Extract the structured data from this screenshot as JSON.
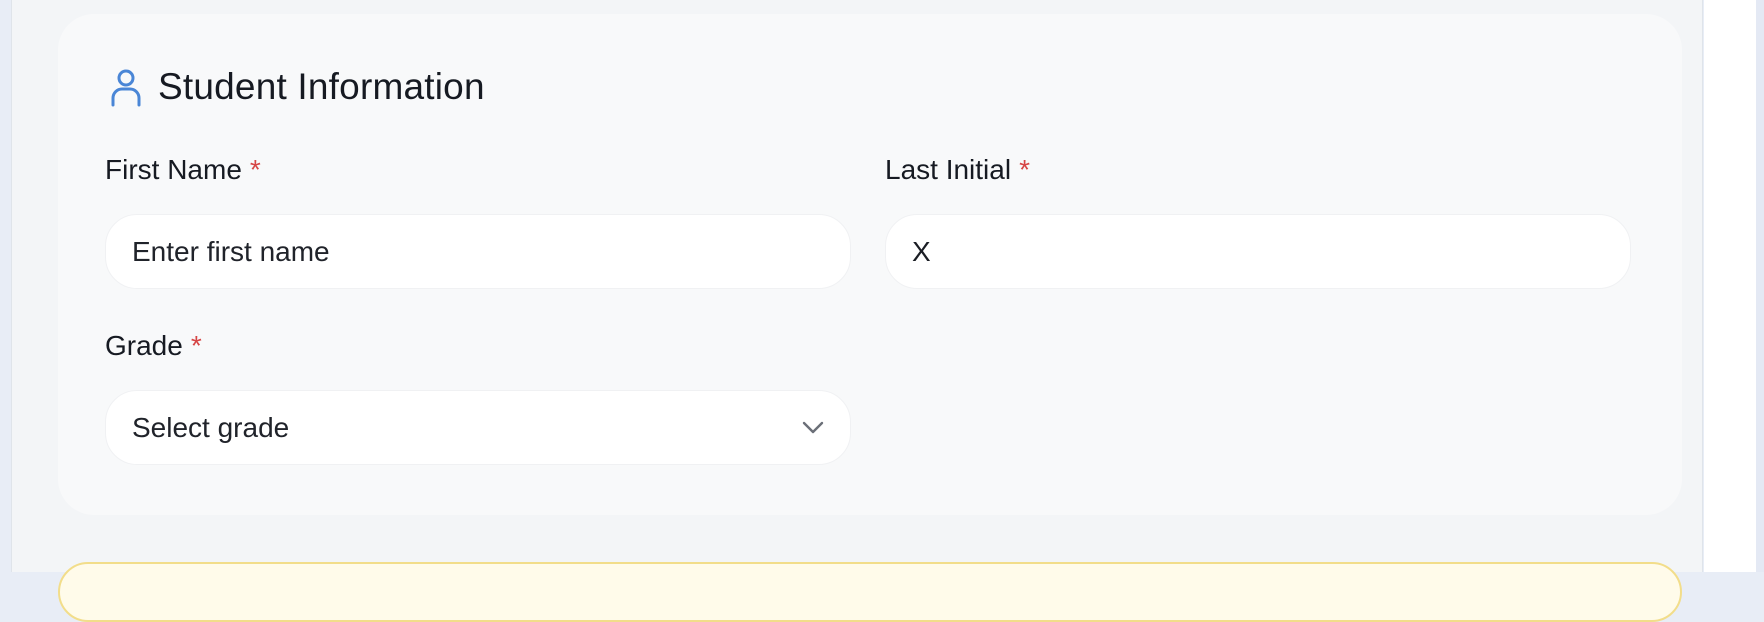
{
  "section": {
    "title": "Student Information",
    "icon": "user-icon",
    "accent_color": "#4a86d6"
  },
  "fields": {
    "first_name": {
      "label": "First Name",
      "required_mark": "*",
      "value": "",
      "placeholder": "Enter first name"
    },
    "last_initial": {
      "label": "Last Initial",
      "required_mark": "*",
      "value": "X",
      "placeholder": ""
    },
    "grade": {
      "label": "Grade",
      "required_mark": "*",
      "selected": "Select grade",
      "icon": "chevron-down-icon"
    }
  },
  "colors": {
    "required": "#d64545",
    "notice_border": "#f2dd8a",
    "notice_bg": "#fffbea"
  }
}
